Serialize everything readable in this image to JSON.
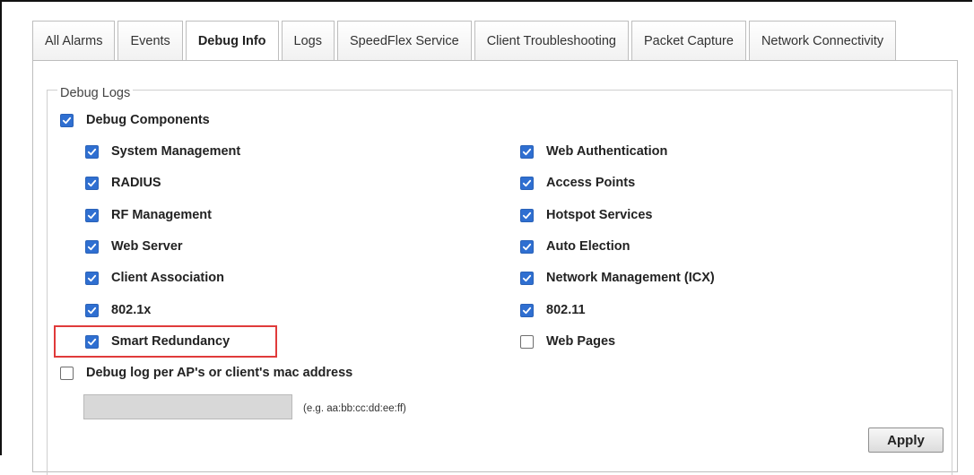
{
  "tabs": [
    {
      "label": "All Alarms",
      "active": false
    },
    {
      "label": "Events",
      "active": false
    },
    {
      "label": "Debug Info",
      "active": true
    },
    {
      "label": "Logs",
      "active": false
    },
    {
      "label": "SpeedFlex Service",
      "active": false
    },
    {
      "label": "Client Troubleshooting",
      "active": false
    },
    {
      "label": "Packet Capture",
      "active": false
    },
    {
      "label": "Network Connectivity",
      "active": false
    }
  ],
  "debug_logs": {
    "legend": "Debug Logs",
    "components": {
      "label": "Debug Components",
      "checked": true
    },
    "left_column": [
      {
        "label": "System Management",
        "checked": true
      },
      {
        "label": "RADIUS",
        "checked": true
      },
      {
        "label": "RF Management",
        "checked": true
      },
      {
        "label": "Web Server",
        "checked": true
      },
      {
        "label": "Client Association",
        "checked": true
      },
      {
        "label": "802.1x",
        "checked": true
      },
      {
        "label": "Smart Redundancy",
        "checked": true
      }
    ],
    "right_column": [
      {
        "label": "Web Authentication",
        "checked": true
      },
      {
        "label": "Access Points",
        "checked": true
      },
      {
        "label": "Hotspot Services",
        "checked": true
      },
      {
        "label": "Auto Election",
        "checked": true
      },
      {
        "label": "Network Management (ICX)",
        "checked": true
      },
      {
        "label": "802.11",
        "checked": true
      },
      {
        "label": "Web Pages",
        "checked": false
      }
    ],
    "mac_filter": {
      "label": "Debug log per AP's or client's mac address",
      "checked": false
    },
    "mac_input": {
      "value": "",
      "placeholder": ""
    },
    "mac_hint": "(e.g. aa:bb:cc:dd:ee:ff)",
    "apply_label": "Apply"
  },
  "colors": {
    "checkbox_checked": "#2f6fd1",
    "highlight_border": "#e03a3a"
  }
}
